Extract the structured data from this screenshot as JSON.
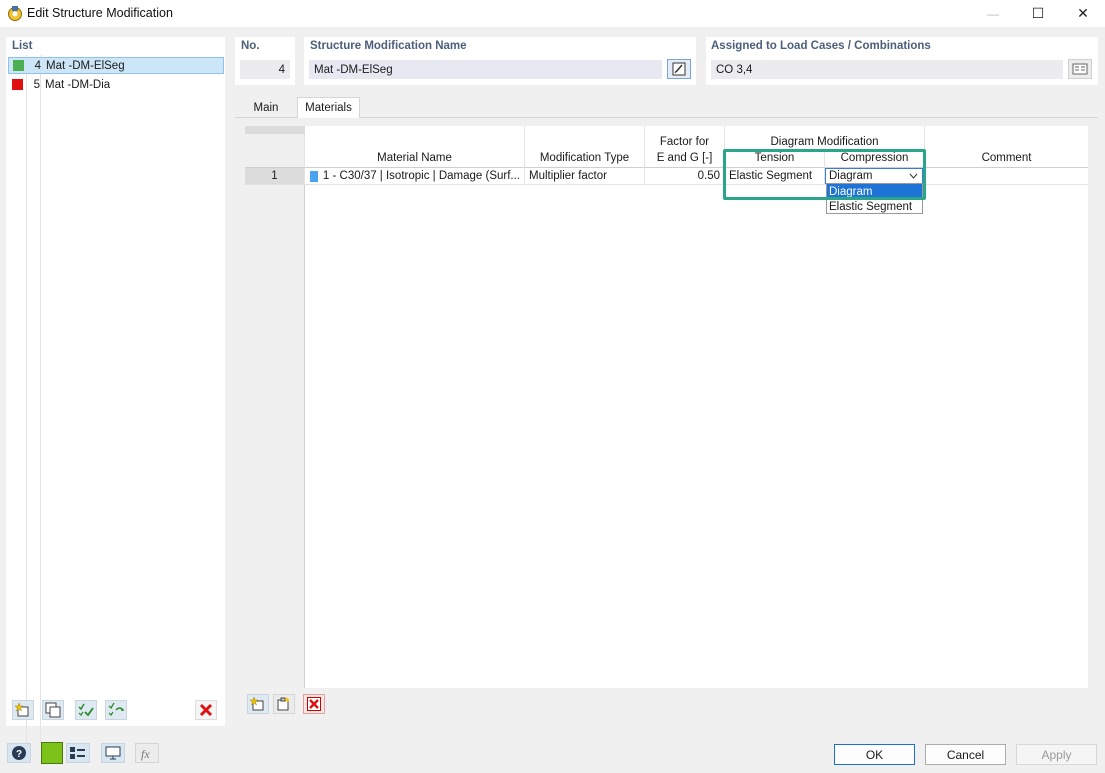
{
  "window": {
    "title": "Edit Structure Modification",
    "minimize_glyph": "—",
    "maximize_glyph": "☐",
    "close_glyph": "✕"
  },
  "list": {
    "label": "List",
    "items": [
      {
        "num": "4",
        "name": "Mat -DM-ElSeg",
        "color": "#4caf50",
        "selected": true
      },
      {
        "num": "5",
        "name": "Mat -DM-Dia",
        "color": "#e01010",
        "selected": false
      }
    ]
  },
  "header": {
    "no_label": "No.",
    "no_value": "4",
    "name_label": "Structure Modification Name",
    "name_value": "Mat -DM-ElSeg",
    "assigned_label": "Assigned to Load Cases / Combinations",
    "assigned_value": "CO 3,4"
  },
  "tabs": [
    {
      "label": "Main",
      "active": false
    },
    {
      "label": "Materials",
      "active": true
    }
  ],
  "table": {
    "col_material": "Material Name",
    "col_modtype": "Modification Type",
    "col_factor_line1": "Factor for",
    "col_factor_line2": "E and G [-]",
    "col_group": "Diagram Modification",
    "col_tension": "Tension",
    "col_compression": "Compression",
    "col_comment": "Comment",
    "rows": [
      {
        "num": "1",
        "material": "1 - C30/37 | Isotropic | Damage (Surf...",
        "material_color": "#4aa3f0",
        "modtype": "Multiplier factor",
        "factor": "0.50",
        "tension": "Elastic Segment",
        "compression": "Diagram",
        "comment": ""
      }
    ]
  },
  "dropdown": {
    "options": [
      "Diagram",
      "Elastic Segment"
    ],
    "highlighted": "Diagram"
  },
  "buttons": {
    "ok": "OK",
    "cancel": "Cancel",
    "apply": "Apply"
  },
  "colors": {
    "accent": "#1e74d6",
    "highlight_frame": "#2aa58a",
    "label_color": "#4b5f7b",
    "green_swatch": "#7cc21a"
  }
}
